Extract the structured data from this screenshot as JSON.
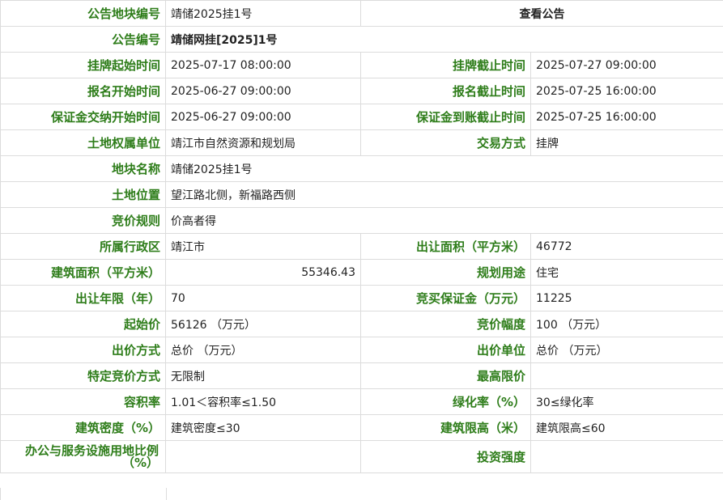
{
  "rows": [
    {
      "l1": "公告地块编号",
      "v1": "靖储2025挂1号",
      "link": "查看公告"
    },
    {
      "l1": "公告编号",
      "v1": "靖储网挂[2025]1号"
    },
    {
      "l1": "挂牌起始时间",
      "v1": "2025-07-17 08:00:00",
      "l2": "挂牌截止时间",
      "v2": "2025-07-27 09:00:00"
    },
    {
      "l1": "报名开始时间",
      "v1": "2025-06-27 09:00:00",
      "l2": "报名截止时间",
      "v2": "2025-07-25 16:00:00"
    },
    {
      "l1": "保证金交纳开始时间",
      "v1": "2025-06-27 09:00:00",
      "l2": "保证金到账截止时间",
      "v2": "2025-07-25 16:00:00"
    },
    {
      "l1": "土地权属单位",
      "v1": "靖江市自然资源和规划局",
      "l2": "交易方式",
      "v2": "挂牌"
    },
    {
      "l1": "地块名称",
      "v1": "靖储2025挂1号"
    },
    {
      "l1": "土地位置",
      "v1": "望江路北侧，新福路西侧"
    },
    {
      "l1": "竞价规则",
      "v1": "价高者得"
    },
    {
      "l1": "所属行政区",
      "v1": "靖江市",
      "l2": "出让面积（平方米）",
      "v2": "46772"
    },
    {
      "l1": "建筑面积（平方米）",
      "v1": "55346.43",
      "l2": "规划用途",
      "v2": "住宅"
    },
    {
      "l1": "出让年限（年）",
      "v1": "70",
      "l2": "竞买保证金（万元）",
      "v2": "11225"
    },
    {
      "l1": "起始价",
      "v1": "56126 （万元）",
      "l2": "竞价幅度",
      "v2": "100 （万元）"
    },
    {
      "l1": "出价方式",
      "v1": "总价 （万元）",
      "l2": "出价单位",
      "v2": "总价 （万元）"
    },
    {
      "l1": "特定竞价方式",
      "v1": "无限制",
      "l2": "最高限价",
      "v2": ""
    },
    {
      "l1": "容积率",
      "v1": "1.01＜容积率≤1.50",
      "l2": "绿化率（%）",
      "v2": "30≤绿化率"
    },
    {
      "l1": "建筑密度（%）",
      "v1": "建筑密度≤30",
      "l2": "建筑限高（米）",
      "v2": "建筑限高≤60"
    },
    {
      "l1": "办公与服务设施用地比例（%）",
      "v1": "",
      "l2": "投资强度",
      "v2": ""
    }
  ]
}
